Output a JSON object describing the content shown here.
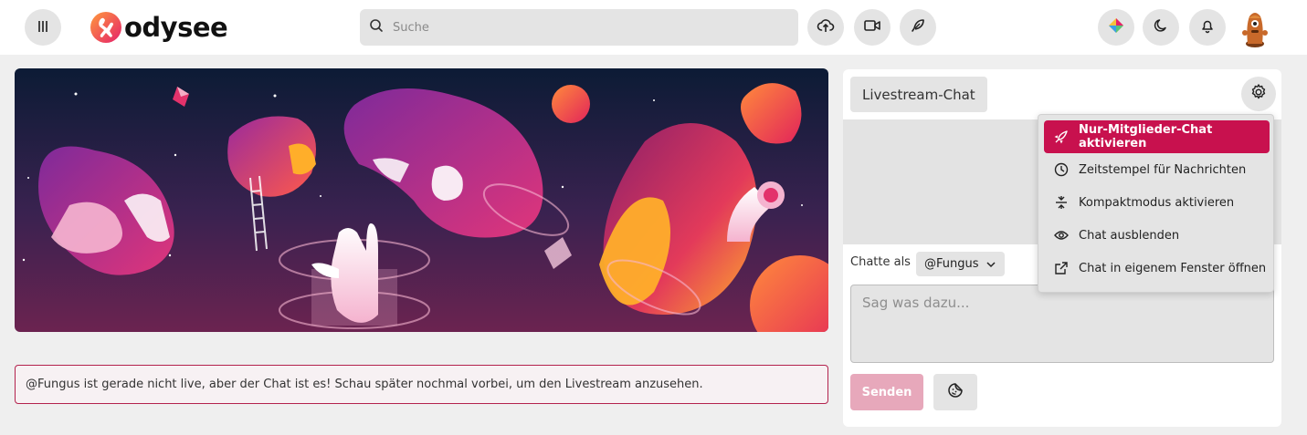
{
  "header": {
    "logo_text": "odysee",
    "search_placeholder": "Suche",
    "menu_icon": "hamburger-icon",
    "upload_icon": "upload-cloud-icon",
    "golive_icon": "video-camera-icon",
    "post_icon": "feather-icon",
    "wallet_icon": "wallet-diamond-icon",
    "theme_icon": "moon-icon",
    "notification_icon": "bell-icon"
  },
  "notice": {
    "text": "@Fungus ist gerade nicht live, aber der Chat ist es! Schau später nochmal vorbei, um den Livestream anzusehen."
  },
  "chat": {
    "tab_label": "Livestream-Chat",
    "chat_as_label": "Chatte als",
    "chat_as_value": "@Fungus",
    "input_placeholder": "Sag was dazu...",
    "send_label": "Senden",
    "menu": [
      {
        "label": "Nur-Mitglieder-Chat aktivieren",
        "icon": "rocket-icon",
        "active": true
      },
      {
        "label": "Zeitstempel für Nachrichten",
        "icon": "clock-icon",
        "active": false
      },
      {
        "label": "Kompaktmodus aktivieren",
        "icon": "compact-icon",
        "active": false
      },
      {
        "label": "Chat ausblenden",
        "icon": "eye-icon",
        "active": false
      },
      {
        "label": "Chat in eigenem Fenster öffnen",
        "icon": "external-link-icon",
        "active": false
      }
    ]
  },
  "colors": {
    "accent": "#c8114e",
    "send_disabled": "#e7a8bb",
    "notice_border": "#b3224d"
  }
}
